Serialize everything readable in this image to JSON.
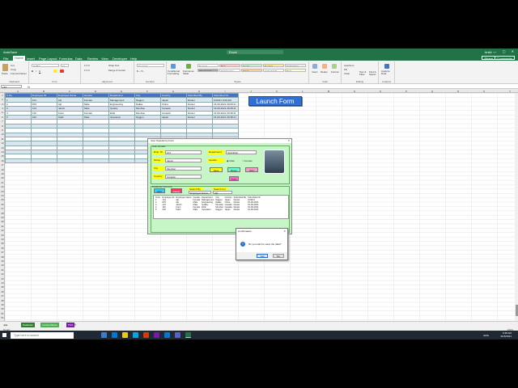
{
  "window": {
    "app": "AutoSave",
    "title": "Excel",
    "user": "Ankit ...",
    "controls": "— ▢ ✕"
  },
  "menu": {
    "items": [
      "File",
      "Home",
      "Insert",
      "Page Layout",
      "Formulas",
      "Data",
      "Review",
      "View",
      "Developer",
      "Help"
    ],
    "active": "Home",
    "share": "Share",
    "comments": "Comments"
  },
  "ribbon": {
    "clipboard": {
      "paste": "Paste",
      "cut": "Cut",
      "copy": "Copy",
      "format_painter": "Format Painter",
      "label": "Clipboard"
    },
    "font": {
      "name": "Calibri",
      "size": "11",
      "label": "Font"
    },
    "alignment": {
      "wrap": "Wrap Text",
      "merge": "Merge & Center",
      "label": "Alignment"
    },
    "number": {
      "format": "General",
      "label": "Number"
    },
    "styles": {
      "cond": "Conditional Formatting",
      "fmt_table": "Format as Table",
      "cells": [
        {
          "t": "Normal",
          "bg": "#ffffff"
        },
        {
          "t": "Bad",
          "bg": "#ffc7ce"
        },
        {
          "t": "Good",
          "bg": "#c6efce"
        },
        {
          "t": "Neutral",
          "bg": "#ffeb9c"
        },
        {
          "t": "Calculation",
          "bg": "#f2f2f2"
        },
        {
          "t": "Check Cell",
          "bg": "#a5a5a5"
        },
        {
          "t": "Explanatory",
          "bg": "#ffffff"
        },
        {
          "t": "Input",
          "bg": "#ffcc99"
        },
        {
          "t": "Linked Cell",
          "bg": "#ffffff"
        },
        {
          "t": "Note",
          "bg": "#ffffcc"
        }
      ],
      "label": "Styles"
    },
    "cells": {
      "insert": "Insert",
      "delete": "Delete",
      "format": "Format",
      "label": "Cells"
    },
    "editing": {
      "autosum": "AutoSum",
      "fill": "Fill",
      "clear": "Clear",
      "sort": "Sort & Filter",
      "find": "Find & Select",
      "label": "Editing"
    },
    "analysis": {
      "analyze": "Analyze Data",
      "label": "Analysis"
    }
  },
  "formula_bar": {
    "namebox": "L22",
    "fx": "fx"
  },
  "columns": [
    "A",
    "B",
    "C",
    "D",
    "E",
    "F",
    "G",
    "H",
    "I",
    "J",
    "K",
    "L",
    "M",
    "N",
    "O",
    "P",
    "Q",
    "R",
    "S",
    "T"
  ],
  "sheet_table": {
    "headers": [
      "S.No.",
      "Employee ID",
      "Employee Name",
      "Gender",
      "Department",
      "City",
      "Country",
      "Submitted By",
      "Submitted On"
    ],
    "rows": [
      [
        "1",
        "101",
        "Ajit",
        "Female",
        "Management",
        "Nagpur",
        "Japan",
        "Daniel",
        "10/9/21 9:09 AM"
      ],
      [
        "2",
        "879",
        "Ajit",
        "Male",
        "Engineering",
        "Dallas",
        "China",
        "Daniel",
        "15-09-2021 09:09:31"
      ],
      [
        "3",
        "124",
        "Jacob",
        "Male",
        "Quality",
        "Mumbai",
        "Canada",
        "Daniel",
        "15-09-2021 09:28:11"
      ],
      [
        "4",
        "116",
        "Kumi",
        "Female",
        "ECE",
        "Mumbai",
        "Canada",
        "Daniel",
        "15-09-2021 09:38:11"
      ],
      [
        "5",
        "232",
        "Kathi",
        "Male",
        "Operation",
        "Nagpur",
        "Japan",
        "Daniel",
        "15-09-2021 09:38:41"
      ]
    ]
  },
  "launch_button": "Launch Form",
  "form": {
    "title": "User Data Entry Form",
    "group_entry": "User Details",
    "labels": {
      "emp_id": "Emp. ID",
      "name": "Name",
      "city": "City",
      "country": "Country",
      "department": "Department",
      "gender": "Gender"
    },
    "values": {
      "emp_id": "101",
      "name": "Jacob",
      "city": "Mumbai",
      "country": "Canada",
      "department": "Operation"
    },
    "gender": {
      "male": "Male",
      "female": "Female"
    },
    "buttons": {
      "save": "Save",
      "reset": "Reset",
      "edit": "Edit",
      "delete": "Delete",
      "print": "Print",
      "exit": "Exit"
    },
    "group_db": "Database Records",
    "search_by": "Search By",
    "search_col": "Employee Name",
    "search_for": "Search For",
    "search_val": "Ajit",
    "listbox": {
      "headers": [
        "S.No.",
        "Employee ID",
        "Employee Name",
        "Gender",
        "Department",
        "City",
        "Country",
        "Submitted By",
        "Submitted On"
      ],
      "rows": [
        [
          "1",
          "101",
          "Ajit",
          "Female",
          "Management",
          "Nagpur",
          "Japan",
          "Daniel",
          "10/9/21"
        ],
        [
          "2",
          "879",
          "Ajit",
          "Male",
          "Engineering",
          "Dallas",
          "China",
          "Daniel",
          "15-09-2021"
        ],
        [
          "3",
          "124",
          "Jacob",
          "Male",
          "Quality",
          "Mumbai",
          "Canada",
          "Daniel",
          "15-09-2021"
        ],
        [
          "4",
          "116",
          "Kumi",
          "Female",
          "ECE",
          "Mumbai",
          "Canada",
          "Daniel",
          "15-09-2021"
        ],
        [
          "5",
          "232",
          "Kathi",
          "Male",
          "Operation",
          "Nagpur",
          "Japan",
          "Daniel",
          "15-09-2021"
        ]
      ]
    }
  },
  "dialog": {
    "title": "Confirmation",
    "message": "Do you want to save the data?",
    "yes": "Yes",
    "no": "No"
  },
  "sheets": [
    {
      "name": "Database",
      "color": "#2e7d32"
    },
    {
      "name": "LookupValues",
      "color": "#4caf50"
    },
    {
      "name": "Print",
      "color": "#7b1fa2"
    }
  ],
  "status": {
    "ready": "Ready",
    "zoom": "100%"
  },
  "taskbar": {
    "search": "Type here to search",
    "time": "9:38 AM",
    "date": "9/15/2021",
    "lang": "ENG"
  }
}
